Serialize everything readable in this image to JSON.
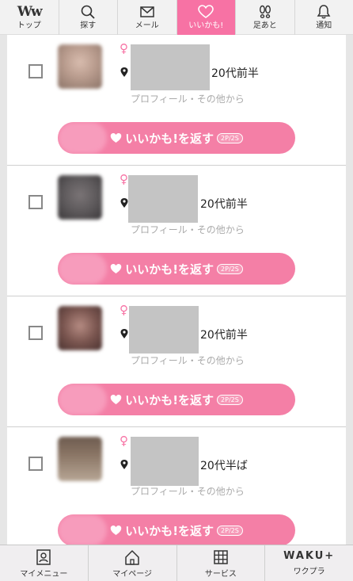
{
  "topnav": {
    "tabs": [
      {
        "label": "トップ",
        "icon": "ww-logo-icon",
        "logo_text": "Ww"
      },
      {
        "label": "探す",
        "icon": "search-icon"
      },
      {
        "label": "メール",
        "icon": "mail-icon"
      },
      {
        "label": "いいかも!",
        "icon": "heart-icon",
        "active": true
      },
      {
        "label": "足あと",
        "icon": "footprints-icon"
      },
      {
        "label": "通知",
        "icon": "bell-icon"
      }
    ]
  },
  "colors": {
    "accent": "#f772a4",
    "button": "#f47fa6"
  },
  "cards": [
    {
      "age": "20代前半",
      "profile_link": "プロフィール・その他から",
      "gender_symbol": "♀",
      "button_label": "いいかも!を返す",
      "cost": "2P/2S",
      "avatar_color": "#b99c8e"
    },
    {
      "age": "20代前半",
      "profile_link": "プロフィール・その他から",
      "gender_symbol": "♀",
      "button_label": "いいかも!を返す",
      "cost": "2P/2S",
      "avatar_color": "#5e5a5c"
    },
    {
      "age": "20代前半",
      "profile_link": "プロフィール・その他から",
      "gender_symbol": "♀",
      "button_label": "いいかも!を返す",
      "cost": "2P/2S",
      "avatar_color": "#7b5650"
    },
    {
      "age": "20代半ば",
      "profile_link": "プロフィール・その他から",
      "gender_symbol": "♀",
      "button_label": "いいかも!を返す",
      "cost": "2P/2S",
      "avatar_color": "#8a7565"
    }
  ],
  "bottomnav": {
    "tabs": [
      {
        "label": "マイメニュー",
        "icon": "user-card-icon"
      },
      {
        "label": "マイページ",
        "icon": "home-icon"
      },
      {
        "label": "サービス",
        "icon": "grid-icon"
      },
      {
        "label": "ワクプラ",
        "icon": "waku-plus-icon",
        "logo_text": "WAKU+"
      }
    ]
  }
}
